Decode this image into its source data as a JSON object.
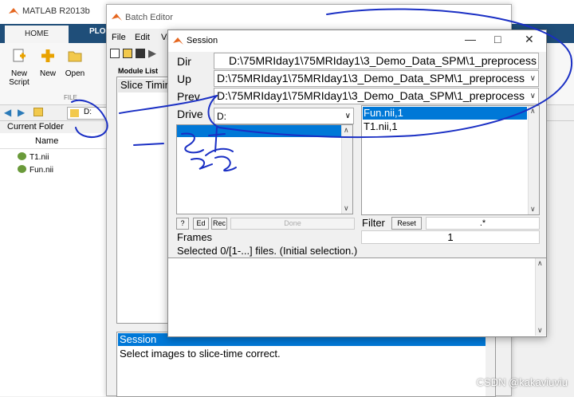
{
  "matlab": {
    "title": "MATLAB R2013b",
    "tabs": [
      "HOME",
      "PLO"
    ],
    "ribbon_buttons": [
      {
        "label": "New\nScript",
        "icon": "new-script-icon"
      },
      {
        "label": "New",
        "icon": "new-icon"
      },
      {
        "label": "Open",
        "icon": "open-folder-icon"
      }
    ],
    "file_group_label": "FILE",
    "address": "D:",
    "current_folder_label": "Current Folder",
    "name_column": "Name",
    "files": [
      "T1.nii",
      "Fun.nii"
    ]
  },
  "batch_editor": {
    "title": "Batch Editor",
    "menu": [
      "File",
      "Edit",
      "Vi"
    ],
    "module_list_label": "Module List",
    "module_item": "Slice Timing",
    "bottom_selected": "Session",
    "bottom_description": "Select images to slice-time correct."
  },
  "session": {
    "title": "Session",
    "dir_label": "Dir",
    "dir_value": "D:\\75MRIday1\\75MRIday1\\3_Demo_Data_SPM\\1_preprocess",
    "up_label": "Up",
    "up_value": "D:\\75MRIday1\\75MRIday1\\3_Demo_Data_SPM\\1_preprocess",
    "prev_label": "Prev",
    "prev_value": "D:\\75MRIday1\\75MRIday1\\3_Demo_Data_SPM\\1_preprocess",
    "drive_label": "Drive",
    "drive_value": "D:",
    "files": [
      "Fun.nii,1",
      "T1.nii,1"
    ],
    "btn_help": "?",
    "btn_ed": "Ed",
    "btn_rec": "Rec",
    "btn_done": "Done",
    "filter_label": "Filter",
    "btn_reset": "Reset",
    "filter_value": ".*",
    "frames_label": "Frames",
    "frames_value": "1",
    "status": "Selected 0/[1-...] files. (Initial selection.)"
  },
  "watermark": "CSDN @kakaviuviu",
  "colors": {
    "selection": "#0078d7",
    "ribbon": "#1f4e79",
    "ink": "#1a2fc4"
  }
}
